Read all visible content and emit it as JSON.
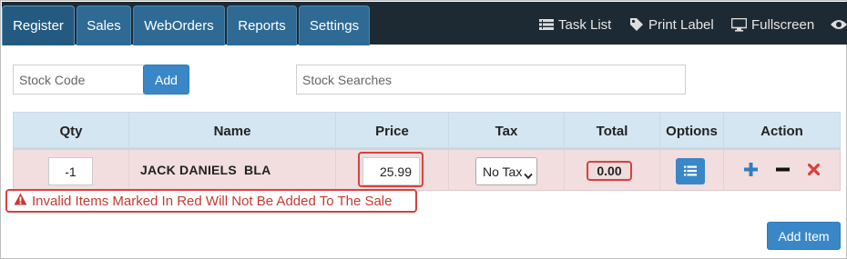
{
  "nav": {
    "tabs": [
      {
        "label": "Register",
        "active": true
      },
      {
        "label": "Sales",
        "active": false
      },
      {
        "label": "WebOrders",
        "active": false
      },
      {
        "label": "Reports",
        "active": false
      },
      {
        "label": "Settings",
        "active": false
      }
    ],
    "links": [
      {
        "label": "Task List",
        "icon": "list-icon"
      },
      {
        "label": "Print Label",
        "icon": "tag-icon"
      },
      {
        "label": "Fullscreen",
        "icon": "monitor-icon"
      },
      {
        "label": "",
        "icon": "eye-icon"
      }
    ]
  },
  "stock": {
    "code_placeholder": "Stock Code",
    "add_label": "Add",
    "search_placeholder": "Stock Searches"
  },
  "table": {
    "headers": [
      "Qty",
      "Name",
      "Price",
      "Tax",
      "Total",
      "Options",
      "Action"
    ],
    "row": {
      "qty": "-1",
      "name": "JACK DANIELS  BLA",
      "price": "25.99",
      "tax": "No Tax",
      "total": "0.00"
    }
  },
  "warning": {
    "text": "Invalid Items Marked In Red Will Not Be Added To The Sale"
  },
  "footer": {
    "add_item_label": "Add Item"
  },
  "colors": {
    "nav_bg": "#1e2a33",
    "tab_bg": "#2e6a93",
    "accent_blue": "#3a87c8",
    "header_bg": "#d4e6f2",
    "invalid_row_bg": "#f2dedf",
    "error_red": "#d9403e"
  }
}
